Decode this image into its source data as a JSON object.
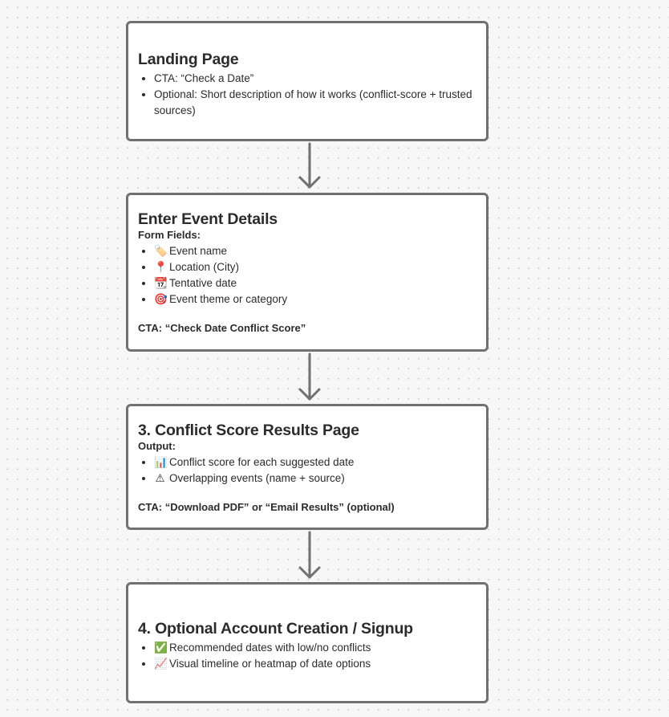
{
  "card1": {
    "title": "Landing Page",
    "items": [
      "CTA: “Check a Date”",
      "Optional: Short description of how it works (conflict-score + trusted sources)"
    ]
  },
  "card2": {
    "title": "Enter Event Details",
    "subheading": "Form Fields:",
    "items": [
      {
        "icon": "🏷️",
        "icon_name": "label-tag-icon",
        "text": "Event name"
      },
      {
        "icon": "📍",
        "icon_name": "location-pin-icon",
        "text": "Location (City)"
      },
      {
        "icon": "📆",
        "icon_name": "calendar-icon",
        "text": "Tentative date"
      },
      {
        "icon": "🎯",
        "icon_name": "target-icon",
        "text": "Event theme or category"
      }
    ],
    "cta": "CTA: “Check Date Conflict Score”"
  },
  "card3": {
    "title": "3. Conflict Score Results Page",
    "subheading": "Output:",
    "items": [
      {
        "icon": "📊",
        "icon_name": "bar-chart-icon",
        "text": "Conflict score for each suggested date"
      },
      {
        "icon": "⚠",
        "icon_name": "warning-icon",
        "text": "Overlapping events (name + source)"
      }
    ],
    "cta": "CTA: “Download PDF” or “Email Results” (optional)"
  },
  "card4": {
    "title": "4. Optional Account Creation / Signup",
    "items": [
      {
        "icon": "✅",
        "icon_name": "check-mark-icon",
        "text": "Recommended dates with low/no conflicts"
      },
      {
        "icon": "📈",
        "icon_name": "trend-chart-icon",
        "text": "Visual timeline or heatmap of date options"
      }
    ]
  },
  "colors": {
    "background": "#f7f7f7",
    "card_border": "#717171",
    "arrow": "#717171",
    "text": "#2b2b2b"
  }
}
